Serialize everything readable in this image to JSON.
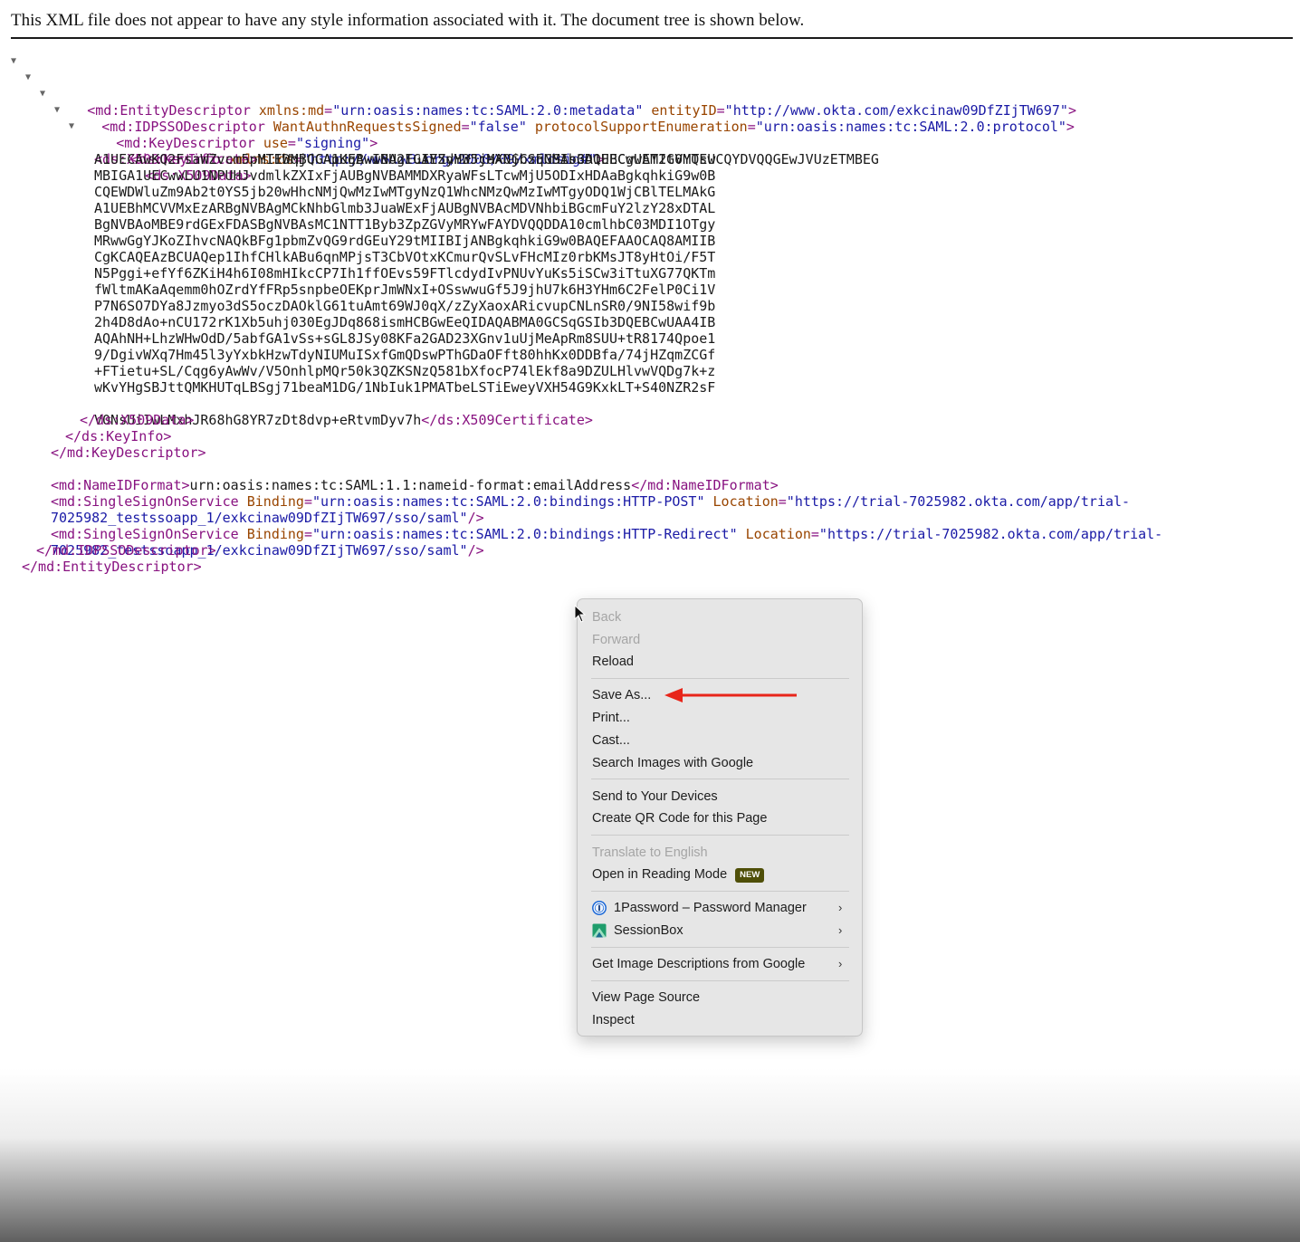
{
  "notice": {
    "text": "This XML file does not appear to have any style information associated with it. The document tree is shown below."
  },
  "xml": {
    "entity_descriptor": {
      "open_tag": "<md:EntityDescriptor",
      "attr1_name": "xmlns:md",
      "attr1_value": "\"urn:oasis:names:tc:SAML:2.0:metadata\"",
      "attr2_name": "entityID",
      "attr2_value": "\"http://www.okta.com/exkcinaw09DfZIjTW697\"",
      "close": ">",
      "end_tag": "</md:EntityDescriptor>"
    },
    "idpsso": {
      "open_tag": "<md:IDPSSODescriptor",
      "attr1_name": "WantAuthnRequestsSigned",
      "attr1_value": "\"false\"",
      "attr2_name": "protocolSupportEnumeration",
      "attr2_value": "\"urn:oasis:names:tc:SAML:2.0:protocol\"",
      "close": ">",
      "end_tag": "</md:IDPSSODescriptor>"
    },
    "key_descriptor": {
      "open_tag": "<md:KeyDescriptor",
      "attr_name": "use",
      "attr_value": "\"signing\"",
      "close": ">",
      "end_tag": "</md:KeyDescriptor>"
    },
    "key_info": {
      "open_tag": "<ds:KeyInfo",
      "attr_name": "xmlns:ds",
      "attr_value": "\"http://www.w3.org/2000/09/xmldsig#\"",
      "close": ">",
      "end_tag": "</ds:KeyInfo>"
    },
    "x509_data": {
      "open_tag": "<ds:X509Data>",
      "end_tag": "</ds:X509Data>"
    },
    "x509_certificate": {
      "open_tag": "<ds:X509Certificate>",
      "end_tag": "</ds:X509Certificate>",
      "lines": [
        "MIIDqjCCApKgAwIBAgIGAY5dH3JcMA0GCSqGSIb3DQEBCwUAMIGVMQswCQYDVQQGEwJVUzETMBEG",
        "A1UECAwKQ2FsaWZvcm5pYTEWMBQGA1UEBwwNU2FuIEZyYW5jaXNjbzENMAsGA1UECgwET2t0YTEU",
        "MBIGA1UECwwLU1NPUHJvdmlkZXIxFjAUBgNVBAMMDXRyaWFsLTcwMjU5ODIxHDAaBgkqhkiG9w0B",
        "CQEWDWluZm9Ab2t0YS5jb20wHhcNMjQwMzIwMTgyNzQ1WhcNMzQwMzIwMTgyODQ1WjCBlTELMAkG",
        "A1UEBhMCVVMxEzARBgNVBAgMCkNhbGlmb3JuaWExFjAUBgNVBAcMDVNhbiBGcmFuY2lzY28xDTAL",
        "BgNVBAoMBE9rdGExFDASBgNVBAsMC1NTT1Byb3ZpZGVyMRYwFAYDVQQDDA10cmlhbC03MDI1OTgy",
        "MRwwGgYJKoZIhvcNAQkBFg1pbmZvQG9rdGEuY29tMIIBIjANBgkqhkiG9w0BAQEFAAOCAQ8AMIIB",
        "CgKCAQEAzBCUAQep1IhfCHlkABu6qnMPjsT3CbVOtxKCmurQvSLvFHcMIz0rbKMsJT8yHtOi/F5T",
        "N5Pggi+efYf6ZKiH4h6I08mHIkcCP7Ih1ffOEvs59FTlcdydIvPNUvYuKs5iSCw3iTtuXG77QKTm",
        "fWltmAKaAqemm0hOZrdYfFRp5snpbeOEKprJmWNxI+OSswwuGf5J9jhU7k6H3YHm6C2FelP0Ci1V",
        "P7N6SO7DYa8Jzmyo3dS5oczDAOklG61tuAmt69WJ0qX/zZyXaoxARicvupCNLnSR0/9NI58wif9b",
        "2h4D8dAo+nCU172rK1Xb5uhj030EgJDq868ismHCBGwEeQIDAQABMA0GCSqGSIb3DQEBCwUAA4IB",
        "AQAhNH+LhzWHwOdD/5abfGA1vSs+sGL8JSy08KFa2GAD23XGnv1uUjMeApRm8SUU+tR8174Qpoe1",
        "9/DgivWXq7Hm45l3yYxbkHzwTdyNIUMuISxfGmQDswPThGDaOFft80hhKx0DDBfa/74jHZqmZCGf",
        "+FTietu+SL/Cqg6yAwWv/V5OnhlpMQr50k3QZKSNzQ581bXfocP74lEkf8a9DZULHlvwVQDg7k+z",
        "wKvYHgSBJttQMKHUTqLBSgj71beaM1DG/1NbIuk1PMATbeLSTiEweyVXH54G9KxkLT+S40NZR2sF",
        "V0NsUiIwLMxhJR68hG8YR7zDt8dvp+eRtvmDyv7h"
      ]
    },
    "nameid": {
      "open_tag": "<md:NameIDFormat>",
      "value": "urn:oasis:names:tc:SAML:1.1:nameid-format:emailAddress",
      "end_tag": "</md:NameIDFormat>"
    },
    "sso_post": {
      "open_tag": "<md:SingleSignOnService",
      "binding_name": "Binding",
      "binding_value": "\"urn:oasis:names:tc:SAML:2.0:bindings:HTTP-POST\"",
      "location_name": "Location",
      "location_value_part1": "\"https://trial-7025982.okta.com/app/trial-",
      "location_value_part2": "7025982_testssoapp_1/exkcinaw09DfZIjTW697/sso/saml\"",
      "close": "/>"
    },
    "sso_redirect": {
      "open_tag": "<md:SingleSignOnService",
      "binding_name": "Binding",
      "binding_value": "\"urn:oasis:names:tc:SAML:2.0:bindings:HTTP-Redirect\"",
      "location_name": "Location",
      "location_value_part1": "\"https://trial-7025982.okta.com/app/trial-",
      "location_value_part2": "7025982_testssoapp_1/exkcinaw09DfZIjTW697/sso/saml\"",
      "close": "/>"
    },
    "toggle_glyph": "▼"
  },
  "context_menu": {
    "back": "Back",
    "forward": "Forward",
    "reload": "Reload",
    "save_as": "Save As...",
    "print": "Print...",
    "cast": "Cast...",
    "search_images": "Search Images with Google",
    "send_devices": "Send to Your Devices",
    "create_qr": "Create QR Code for this Page",
    "translate": "Translate to English",
    "reading_mode": "Open in Reading Mode",
    "new_badge": "NEW",
    "onepassword": "1Password – Password Manager",
    "sessionbox": "SessionBox",
    "image_descriptions": "Get Image Descriptions from Google",
    "view_source": "View Page Source",
    "inspect": "Inspect",
    "submenu_glyph": "›"
  },
  "colors": {
    "tag": "#881280",
    "attr_name": "#994500",
    "attr_value": "#1a1aa6",
    "annotation_arrow": "#e8251a",
    "menu_bg": "#e6e6e6",
    "new_badge_bg": "#4f4f08"
  },
  "icons": {
    "onepassword": "1password-icon",
    "sessionbox": "sessionbox-icon",
    "cursor": "mouse-pointer-icon",
    "annotation": "red-arrow-annotation"
  }
}
